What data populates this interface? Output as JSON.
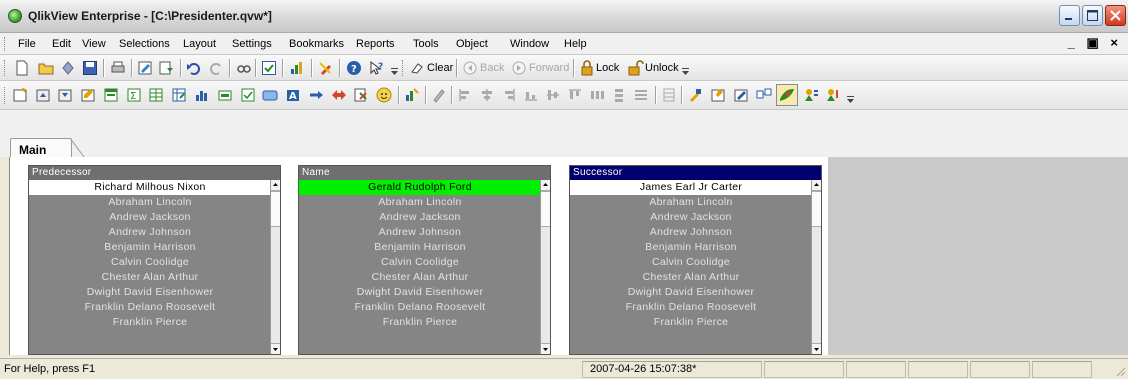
{
  "window": {
    "title": "QlikView Enterprise - [C:\\Presidenter.qvw*]"
  },
  "menu": {
    "items": [
      "File",
      "Edit",
      "View",
      "Selections",
      "Layout",
      "Settings",
      "Bookmarks",
      "Reports",
      "Tools",
      "Object",
      "Window",
      "Help"
    ],
    "mdi_controls": "_ ð ×"
  },
  "toolbar1": {
    "clear_label": "Clear",
    "back_label": "Back",
    "forward_label": "Forward",
    "lock_label": "Lock",
    "unlock_label": "Unlock"
  },
  "tabs": [
    {
      "label": "Main"
    }
  ],
  "listboxes": [
    {
      "caption": "Predecessor",
      "items": [
        "Richard Milhous Nixon",
        "Abraham Lincoln",
        "Andrew Jackson",
        "Andrew Johnson",
        "Benjamin Harrison",
        "Calvin Coolidge",
        "Chester Alan Arthur",
        "Dwight David Eisenhower",
        "Franklin Delano Roosevelt",
        "Franklin Pierce"
      ]
    },
    {
      "caption": "Name",
      "items": [
        "Gerald Rudolph Ford",
        "Abraham Lincoln",
        "Andrew Jackson",
        "Andrew Johnson",
        "Benjamin Harrison",
        "Calvin Coolidge",
        "Chester Alan Arthur",
        "Dwight David Eisenhower",
        "Franklin Delano Roosevelt",
        "Franklin Pierce"
      ]
    },
    {
      "caption": "Successor",
      "items": [
        "James Earl Jr Carter",
        "Abraham Lincoln",
        "Andrew Jackson",
        "Andrew Johnson",
        "Benjamin Harrison",
        "Calvin Coolidge",
        "Chester Alan Arthur",
        "Dwight David Eisenhower",
        "Franklin Delano Roosevelt",
        "Franklin Pierce"
      ]
    }
  ],
  "colors": {
    "selected": "#00f000",
    "possible": "#ffffff",
    "excluded": "#858585",
    "active_caption": "#00006e"
  },
  "status": {
    "help": "For Help, press F1",
    "timestamp": "2007-04-26 15:07:38*"
  }
}
